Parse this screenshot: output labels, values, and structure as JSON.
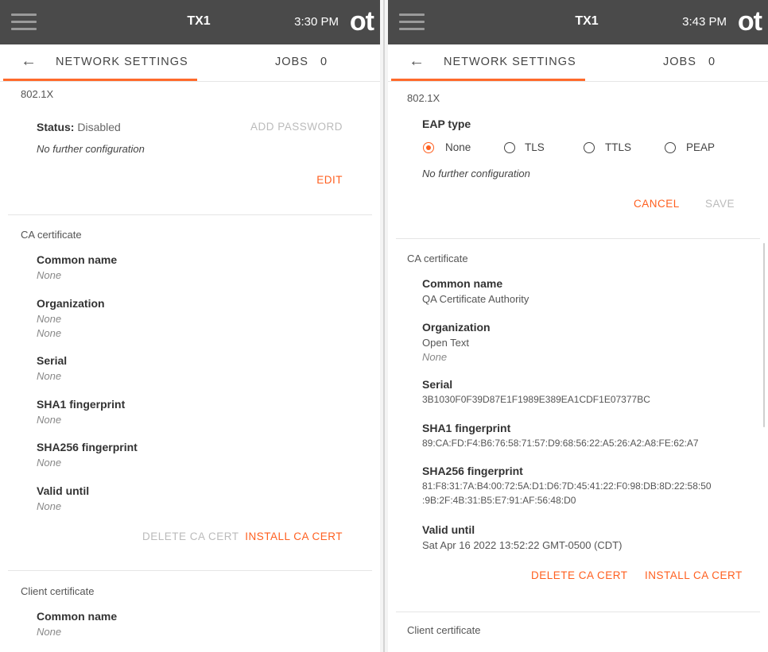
{
  "left": {
    "topbar": {
      "device": "TX1",
      "time": "3:30 PM",
      "logo": "ot"
    },
    "subbar": {
      "back_icon": "arrow-left-icon",
      "title": "NETWORK SETTINGS",
      "jobs_label": "JOBS",
      "jobs_count": "0"
    },
    "dot1x": {
      "title": "802.1X",
      "status_label": "Status:",
      "status_value": "Disabled",
      "add_password": "ADD PASSWORD",
      "note": "No further configuration",
      "edit": "EDIT"
    },
    "ca": {
      "title": "CA certificate",
      "common_name_label": "Common name",
      "common_name_value": "None",
      "organization_label": "Organization",
      "organization_value_1": "None",
      "organization_value_2": "None",
      "serial_label": "Serial",
      "serial_value": "None",
      "sha1_label": "SHA1 fingerprint",
      "sha1_value": "None",
      "sha256_label": "SHA256 fingerprint",
      "sha256_value": "None",
      "valid_label": "Valid until",
      "valid_value": "None",
      "delete": "DELETE CA CERT",
      "install": "INSTALL CA CERT"
    },
    "client": {
      "title": "Client certificate",
      "common_name_label": "Common name",
      "common_name_value": "None"
    }
  },
  "right": {
    "topbar": {
      "device": "TX1",
      "time": "3:43 PM",
      "logo": "ot"
    },
    "subbar": {
      "back_icon": "arrow-left-icon",
      "title": "NETWORK SETTINGS",
      "jobs_label": "JOBS",
      "jobs_count": "0"
    },
    "dot1x": {
      "title": "802.1X",
      "eap_label": "EAP type",
      "options": [
        "None",
        "TLS",
        "TTLS",
        "PEAP"
      ],
      "selected": "None",
      "note": "No further configuration",
      "cancel": "CANCEL",
      "save": "SAVE"
    },
    "ca": {
      "title": "CA certificate",
      "common_name_label": "Common name",
      "common_name_value": "QA Certificate Authority",
      "organization_label": "Organization",
      "organization_value_1": "Open Text",
      "organization_value_2": "None",
      "serial_label": "Serial",
      "serial_value": "3B1030F0F39D87E1F1989E389EA1CDF1E07377BC",
      "sha1_label": "SHA1 fingerprint",
      "sha1_value": "89:CA:FD:F4:B6:76:58:71:57:D9:68:56:22:A5:26:A2:A8:FE:62:A7",
      "sha256_label": "SHA256 fingerprint",
      "sha256_value_1": "81:F8:31:7A:B4:00:72:5A:D1:D6:7D:45:41:22:F0:98:DB:8D:22:58:50",
      "sha256_value_2": ":9B:2F:4B:31:B5:E7:91:AF:56:48:D0",
      "valid_label": "Valid until",
      "valid_value": "Sat Apr 16 2022 13:52:22 GMT-0500 (CDT)",
      "delete": "DELETE CA CERT",
      "install": "INSTALL CA CERT"
    },
    "client": {
      "title": "Client certificate"
    }
  },
  "colors": {
    "accent": "#ff5f1f",
    "topbar": "#4a4a4a",
    "disabled": "#bbbbbb"
  }
}
